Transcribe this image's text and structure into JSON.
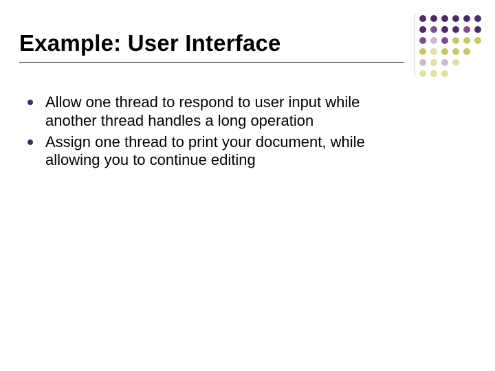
{
  "slide": {
    "title": "Example: User Interface",
    "bullets": [
      "Allow one thread to respond to user input while another thread handles a long operation",
      "Assign one thread to print your document, while allowing you to continue editing"
    ]
  }
}
